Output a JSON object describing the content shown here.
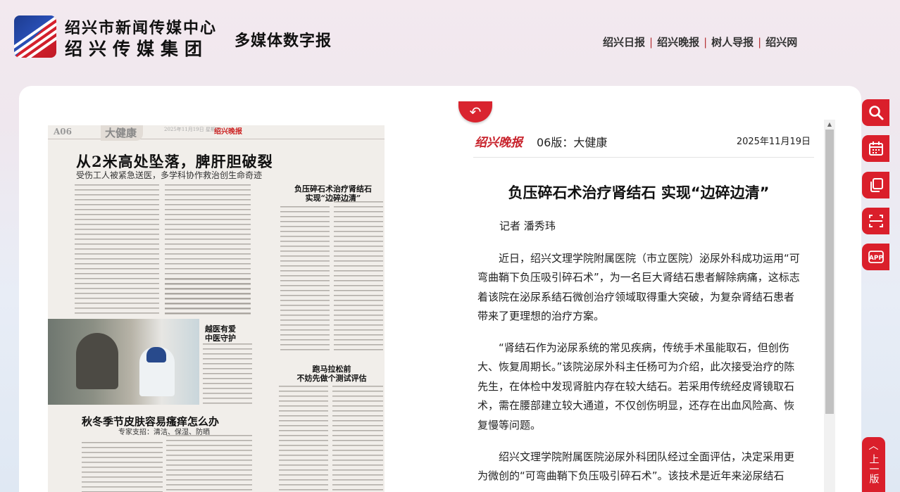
{
  "header": {
    "org_name": "绍兴市新闻传媒中心",
    "org_group": "绍兴传媒集团",
    "site_title": "多媒体数字报",
    "links": [
      "绍兴日报",
      "绍兴晚报",
      "树人导报",
      "绍兴网"
    ],
    "separator": "|"
  },
  "newspaper_page": {
    "page_no": "A06",
    "section": "大健康",
    "date": "2025年11月19日 星期三",
    "masthead": "绍兴晚报",
    "headline": "从2米高处坠落，脾肝胆破裂",
    "subheadline": "受伤工人被紧急送医，多学科协作救治创生命奇迹",
    "story2_title": "负压碎石术治疗肾结石\n实现“边碎边清”",
    "story3_title": "越医有爱\n中医守护",
    "story4_title": "跑马拉松前\n不妨先做个测试评估",
    "story5_title": "秋冬季节皮肤容易瘙痒怎么办",
    "story5_sub": "专家支招：清洁、保湿、防晒"
  },
  "reader": {
    "back_icon": "back-arrow-icon",
    "masthead": "绍兴晚报",
    "edition": "06版：大健康",
    "date": "2025年11月19日",
    "title": "负压碎石术治疗肾结石 实现“边碎边清”",
    "author": "记者 潘秀玮",
    "paragraphs": [
      "近日，绍兴文理学院附属医院（市立医院）泌尿外科成功运用“可弯曲鞘下负压吸引碎石术”，为一名巨大肾结石患者解除病痛，这标志着该院在泌尿系结石微创治疗领域取得重大突破，为复杂肾结石患者带来了更理想的治疗方案。",
      "“肾结石作为泌尿系统的常见疾病，传统手术虽能取石，但创伤大、恢复周期长。”该院泌尿外科主任杨可为介绍，此次接受治疗的陈先生，在体检中发现肾脏内存在较大结石。若采用传统经皮肾镜取石术，需在腰部建立较大通道，不仅创伤明显，还存在出血风险高、恢复慢等问题。",
      "绍兴文理学院附属医院泌尿外科团队经过全面评估，决定采用更为微创的“可弯曲鞘下负压吸引碎石术”。该技术是近年来泌尿结石"
    ]
  },
  "side_tools": {
    "items": [
      "search-icon",
      "calendar-icon",
      "copy-icon",
      "scan-icon",
      "app-icon"
    ],
    "app_label": "APP",
    "top_label": "上一版",
    "top_chevron": "︿"
  }
}
